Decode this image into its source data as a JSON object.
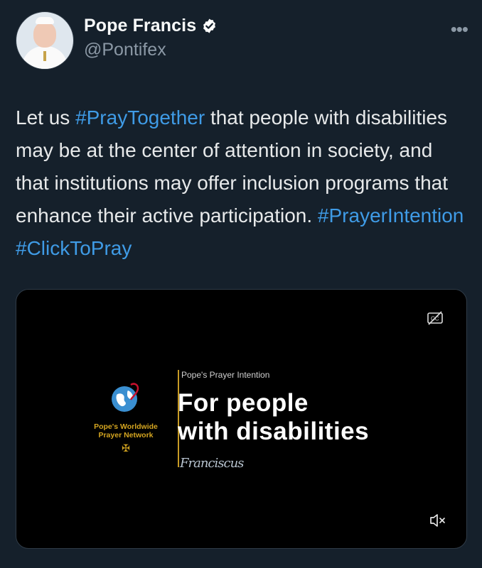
{
  "author": {
    "display_name": "Pope Francis",
    "handle": "@Pontifex",
    "verified": true
  },
  "more_menu": {
    "icon": "more-horizontal-icon",
    "label": "•••"
  },
  "tweet": {
    "segments": [
      {
        "text": "Let us ",
        "type": "text"
      },
      {
        "text": "#PrayTogether",
        "type": "hashtag"
      },
      {
        "text": " that people with disabilities may be at the center of attention in society, and that institutions may offer inclusion programs that enhance their active participation. ",
        "type": "text"
      },
      {
        "text": "#PrayerIntention",
        "type": "hashtag"
      },
      {
        "text": " ",
        "type": "text"
      },
      {
        "text": "#ClickToPray",
        "type": "hashtag"
      }
    ]
  },
  "media": {
    "logo_text": "Pope's Worldwide\nPrayer Network",
    "subtitle": "Pope's Prayer Intention",
    "title_line1": "For people",
    "title_line2": "with disabilities",
    "signature": "Franciscus",
    "captions_icon": "closed-captions-off-icon",
    "mute_icon": "volume-muted-icon"
  },
  "colors": {
    "background": "#15202b",
    "hashtag": "#3f9be6",
    "verified_badge": "#ffffff",
    "network_gold": "#d4a520"
  }
}
